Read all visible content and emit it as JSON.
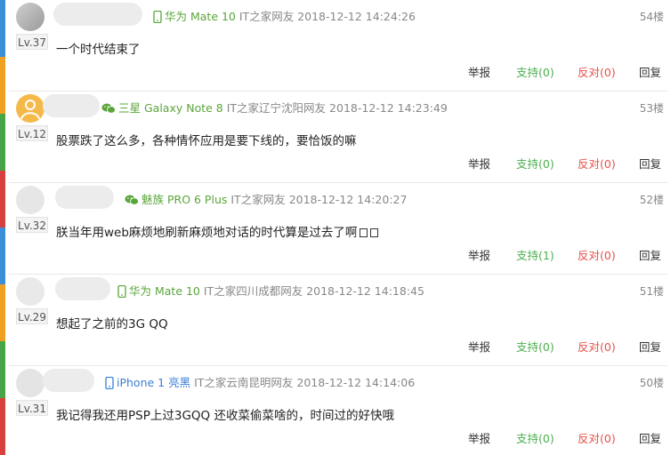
{
  "comments": [
    {
      "level": "Lv.37",
      "device": "华为 Mate 10",
      "device_icon": "phone-icon",
      "source": "IT之家网友",
      "time": "2018-12-12 14:24:26",
      "floor": "54楼",
      "content": "一个时代结束了",
      "report": "举报",
      "support": "支持(0)",
      "oppose": "反对(0)",
      "reply": "回复"
    },
    {
      "level": "Lv.12",
      "device": "三星 Galaxy Note 8",
      "device_icon": "wechat-icon",
      "source": "IT之家辽宁沈阳网友",
      "time": "2018-12-12 14:23:49",
      "floor": "53楼",
      "content": "股票跌了这么多，各种情怀应用是要下线的，要恰饭的嘛",
      "report": "举报",
      "support": "支持(0)",
      "oppose": "反对(0)",
      "reply": "回复"
    },
    {
      "level": "Lv.32",
      "device": "魅族 PRO 6 Plus",
      "device_icon": "wechat-icon",
      "source": "IT之家网友",
      "time": "2018-12-12 14:20:27",
      "floor": "52楼",
      "content": "朕当年用web麻烦地刷新麻烦地对话的时代算是过去了啊",
      "report": "举报",
      "support": "支持(1)",
      "oppose": "反对(0)",
      "reply": "回复"
    },
    {
      "level": "Lv.29",
      "device": "华为 Mate 10",
      "device_icon": "phone-icon",
      "source": "IT之家四川成都网友",
      "time": "2018-12-12 14:18:45",
      "floor": "51楼",
      "content": "想起了之前的3G QQ",
      "report": "举报",
      "support": "支持(0)",
      "oppose": "反对(0)",
      "reply": "回复"
    },
    {
      "level": "Lv.31",
      "device": "iPhone 1 亮黑",
      "device_icon": "iphone-icon",
      "source": "IT之家云南昆明网友",
      "time": "2018-12-12 14:14:06",
      "floor": "50楼",
      "content": "我记得我还用PSP上过3GQQ 还收菜偷菜啥的，时间过的好快哦",
      "report": "举报",
      "support": "支持(0)",
      "oppose": "反对(0)",
      "reply": "回复"
    }
  ],
  "colors": {
    "support": "#4caf50",
    "oppose": "#e8504a",
    "device_green": "#5aa53a",
    "device_blue": "#3a7fd5"
  }
}
